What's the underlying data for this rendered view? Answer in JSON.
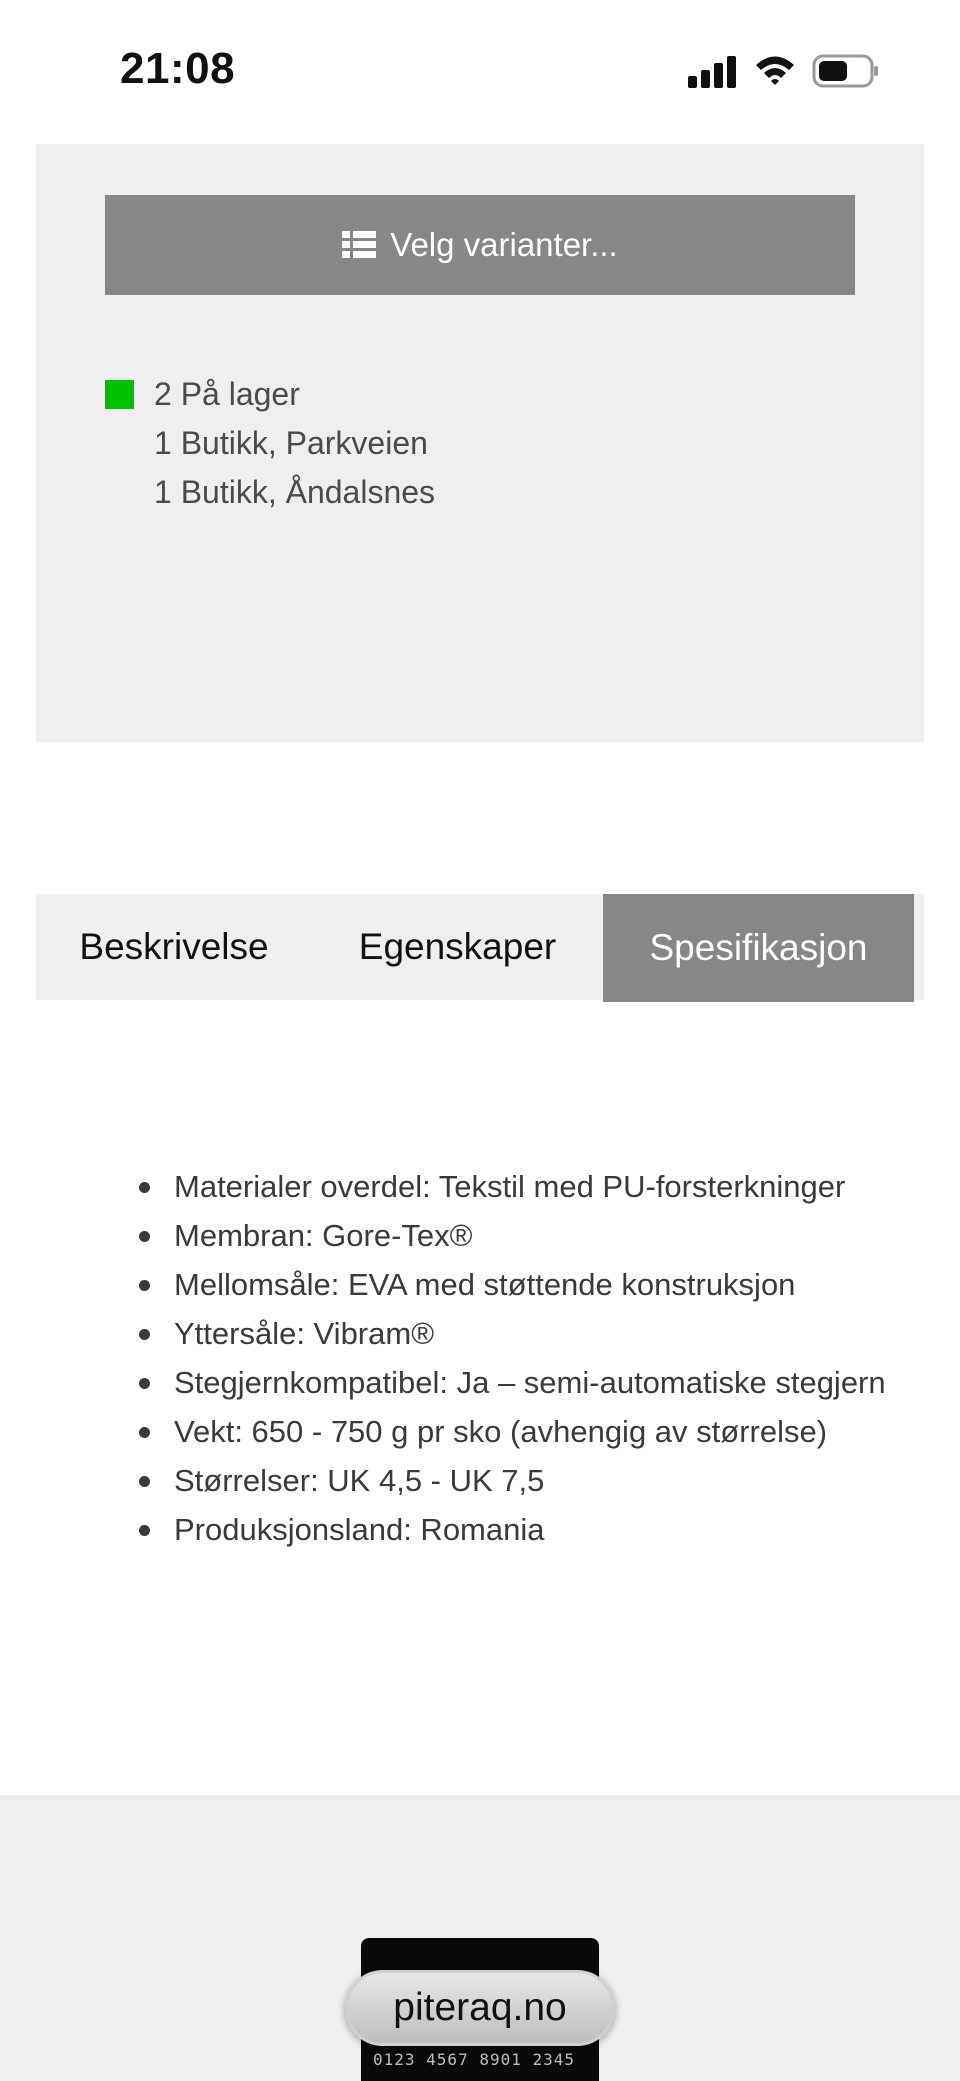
{
  "status_bar": {
    "time": "21:08"
  },
  "variant_selector": {
    "button_label": "Velg varianter...",
    "icon": "list-icon"
  },
  "stock": {
    "status_color": "#00c000",
    "total": "2 På lager",
    "locations": [
      "1 Butikk, Parkveien",
      "1 Butikk, Åndalsnes"
    ]
  },
  "tabs": [
    {
      "label": "Beskrivelse",
      "active": false
    },
    {
      "label": "Egenskaper",
      "active": false
    },
    {
      "label": "Spesifikasjon",
      "active": true
    }
  ],
  "specifications": [
    "Materialer overdel: Tekstil med PU-forsterkninger",
    "Membran: Gore-Tex®",
    "Mellomsåle: EVA med støttende konstruksjon",
    "Yttersåle: Vibram®",
    "Stegjernkompatibel: Ja – semi-automatiske stegjern",
    "Vekt: 650 - 750 g pr sko (avhengig av størrelse)",
    "Størrelser: UK 4,5 - UK 7,5",
    "Produksjonsland: Romania"
  ],
  "footer": {
    "card_number": "0123 4567 8901 2345"
  },
  "browser": {
    "url": "piteraq.no"
  },
  "colors": {
    "active_tab": "#878787",
    "panel_bg": "#efefef",
    "in_stock": "#00c000"
  }
}
